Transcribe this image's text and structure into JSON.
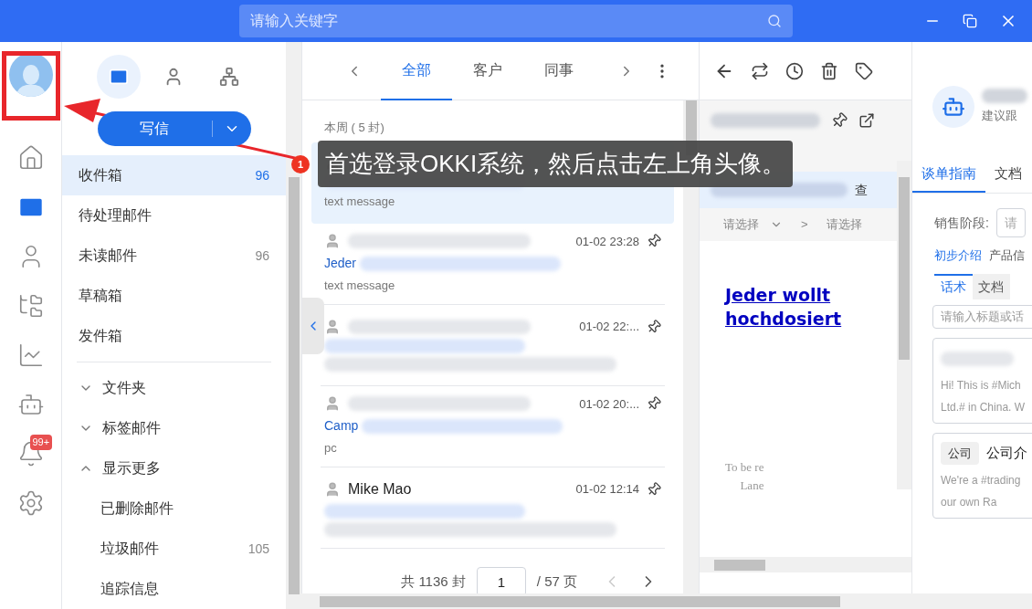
{
  "top_bar": {
    "search": {
      "placeholder": "请输入关键字"
    }
  },
  "rail": {
    "items": [
      {
        "kind": "home",
        "selected": false
      },
      {
        "kind": "mail",
        "selected": true
      },
      {
        "kind": "contacts",
        "selected": false
      },
      {
        "kind": "folders",
        "selected": false
      },
      {
        "kind": "chart",
        "selected": false
      },
      {
        "kind": "robot",
        "selected": false
      },
      {
        "kind": "bell",
        "selected": false,
        "badge": "99+"
      },
      {
        "kind": "settings",
        "selected": false
      }
    ]
  },
  "nav": {
    "tabs": [
      {
        "kind": "mail",
        "selected": true
      },
      {
        "kind": "contacts",
        "selected": false
      },
      {
        "kind": "org",
        "selected": false
      }
    ],
    "compose": {
      "label": "写信"
    },
    "items": [
      {
        "kind": "item",
        "label": "收件箱",
        "count": "96",
        "selected": true
      },
      {
        "kind": "item",
        "label": "待处理邮件",
        "selected": false
      },
      {
        "kind": "item",
        "label": "未读邮件",
        "count": "96",
        "selected": false
      },
      {
        "kind": "item",
        "label": "草稿箱",
        "selected": false
      },
      {
        "kind": "item",
        "label": "发件箱",
        "selected": false
      },
      {
        "kind": "divider"
      },
      {
        "kind": "group",
        "label": "文件夹",
        "expanded": false
      },
      {
        "kind": "group",
        "label": "标签邮件",
        "expanded": false
      },
      {
        "kind": "group",
        "label": "显示更多",
        "expanded": true
      },
      {
        "kind": "sub",
        "label": "已删除邮件",
        "selected": false
      },
      {
        "kind": "sub",
        "label": "垃圾邮件",
        "count": "105",
        "selected": false
      },
      {
        "kind": "sub",
        "label": "追踪信息",
        "selected": false
      }
    ]
  },
  "mail_list": {
    "tabs": [
      {
        "label": "全部",
        "selected": true
      },
      {
        "label": "客户",
        "selected": false
      },
      {
        "label": "同事",
        "selected": false
      }
    ],
    "group": "本周 ( 5 封)",
    "mails": [
      {
        "preview": "text message",
        "selected": true
      },
      {
        "time": "01-02 23:28",
        "subject": "Jeder",
        "preview": "text message",
        "selected": false
      },
      {
        "time": "01-02 22:...",
        "selected": false
      },
      {
        "time": "01-02 20:...",
        "subject": "Camp",
        "preview": "pc",
        "selected": false
      },
      {
        "sender": "Mike Mao",
        "time": "01-02 12:14",
        "selected": false
      }
    ],
    "pagination": {
      "total": "共 1136 封",
      "page": "1",
      "pages": "/ 57 页"
    }
  },
  "reader": {
    "action": "查",
    "breadcrumb": [
      {
        "label": "请选择"
      },
      {
        "label": "请选择"
      }
    ],
    "separator": ">",
    "body_link": [
      "Jeder wollt",
      "hochdosiert"
    ],
    "footer": [
      "To be re",
      "Lane"
    ]
  },
  "assistant": {
    "subtitle": "建议跟",
    "tabs": [
      {
        "label": "谈单指南",
        "selected": true
      },
      {
        "label": "文档",
        "selected": false
      }
    ],
    "stage_label": "销售阶段:",
    "stage_value": "请",
    "topics": [
      {
        "label": "初步介绍",
        "selected": true
      },
      {
        "label": "产品信",
        "selected": false
      }
    ],
    "subtabs": [
      {
        "label": "话术",
        "selected": true
      },
      {
        "label": "文档",
        "selected": false
      }
    ],
    "search": {
      "placeholder": "请输入标题或话"
    },
    "cards": [
      {
        "lines": [
          "Hi! This is #Mich",
          "Ltd.# in China. W"
        ]
      },
      {
        "tag": "公司",
        "title": "公司介",
        "lines": [
          "We're a #trading",
          "our own Ra"
        ]
      }
    ]
  },
  "annotation": {
    "step": "1",
    "text": "首选登录OKKI系统，然后点击左上角头像。"
  }
}
